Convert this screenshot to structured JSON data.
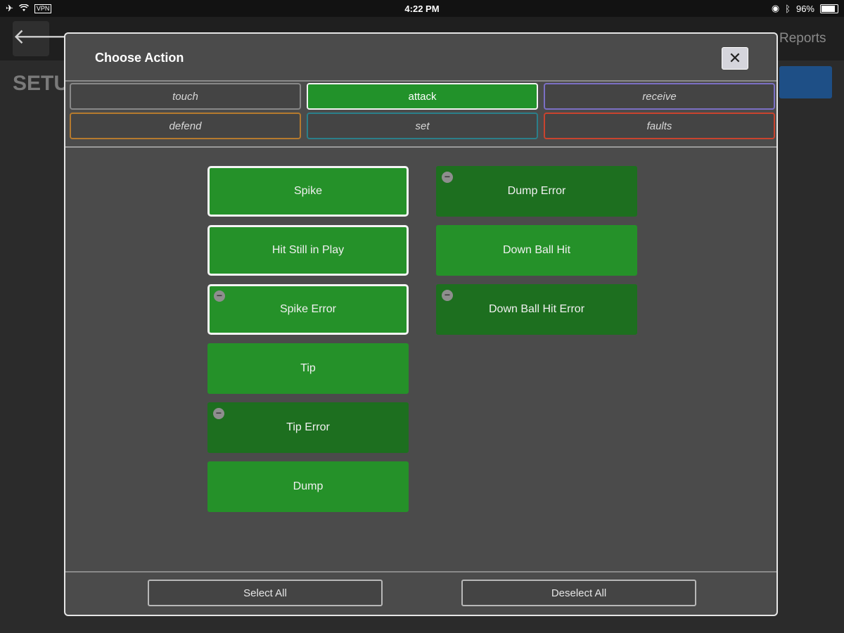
{
  "status_bar": {
    "time": "4:22 PM",
    "vpn": "VPN",
    "battery": "96%",
    "battery_level": 0.96
  },
  "background": {
    "page_title": "SETU",
    "reports_link": "Reports"
  },
  "modal": {
    "title": "Choose Action",
    "close_label": "✕",
    "tabs": [
      {
        "label": "touch",
        "color": "#888888",
        "active": false
      },
      {
        "label": "attack",
        "color": "#f2f2f2",
        "active": true
      },
      {
        "label": "receive",
        "color": "#7b6fc4",
        "active": false
      },
      {
        "label": "defend",
        "color": "#b57a2e",
        "active": false
      },
      {
        "label": "set",
        "color": "#2b7f8a",
        "active": false
      },
      {
        "label": "faults",
        "color": "#c9432e",
        "active": false
      }
    ],
    "left_actions": [
      {
        "label": "Spike",
        "selected": true,
        "error": false
      },
      {
        "label": "Hit Still in Play",
        "selected": true,
        "error": false
      },
      {
        "label": "Spike Error",
        "selected": true,
        "error": false,
        "minus": true
      },
      {
        "label": "Tip",
        "selected": false,
        "error": false
      },
      {
        "label": "Tip Error",
        "selected": false,
        "error": true,
        "minus": true
      },
      {
        "label": "Dump",
        "selected": false,
        "error": false
      }
    ],
    "right_actions": [
      {
        "label": "Dump Error",
        "selected": false,
        "error": true,
        "minus": true
      },
      {
        "label": "Down Ball Hit",
        "selected": false,
        "error": false
      },
      {
        "label": "Down Ball Hit Error",
        "selected": false,
        "error": true,
        "minus": true
      }
    ],
    "footer": {
      "select_all": "Select All",
      "deselect_all": "Deselect All"
    }
  },
  "colors": {
    "accent_green": "#259129",
    "error_green": "#1d6f1f",
    "modal_bg": "#4b4b4b"
  }
}
